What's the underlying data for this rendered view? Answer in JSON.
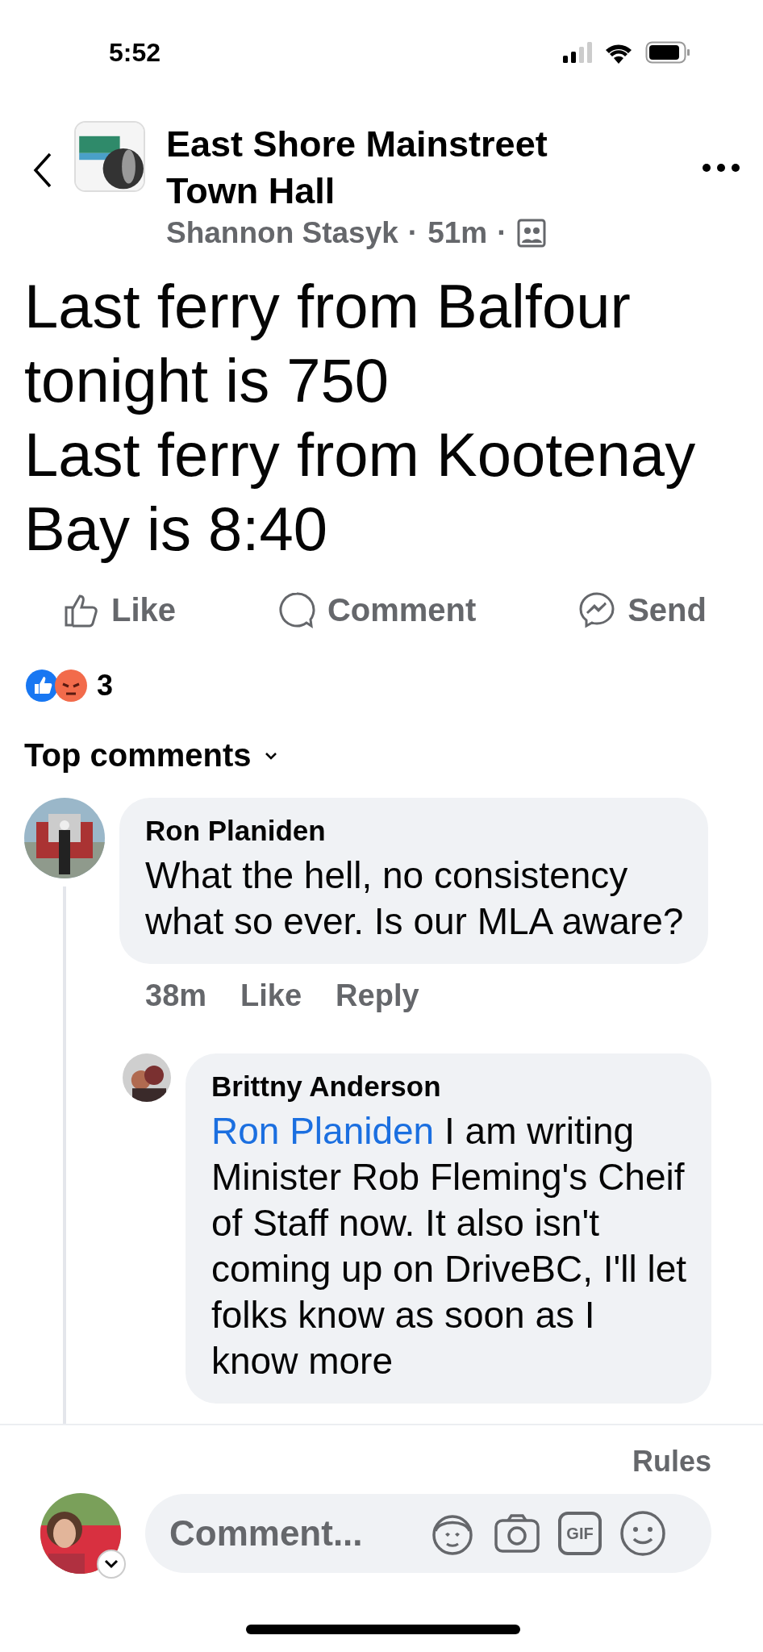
{
  "status_bar": {
    "time": "5:52"
  },
  "header": {
    "group": "East Shore Mainstreet Town Hall",
    "byline": [
      "Shannon Stasyk",
      "·",
      "51m",
      "·"
    ]
  },
  "post": {
    "paragraphs": [
      "Last ferry from Balfour tonight is 750",
      "Last ferry from Kootenay Bay is 8:40"
    ]
  },
  "actions": [
    {
      "kind": "like",
      "label": "Like"
    },
    {
      "kind": "comment",
      "label": "Comment"
    },
    {
      "kind": "send",
      "label": "Send"
    }
  ],
  "reactions": {
    "count": "3"
  },
  "comments_header": {
    "title": "Top comments"
  },
  "comments": [
    {
      "author": "Ron Planiden",
      "text": "What the hell, no consistency what so ever. Is our MLA aware?",
      "time": "38m",
      "actions": [
        "Like",
        "Reply"
      ],
      "replies": [
        {
          "author": "Brittny Anderson",
          "mention": "Ron Planiden",
          "text": "I am writing Minister Rob Fleming's Cheif of Staff now. It also isn't coming up on DriveBC, I'll let folks know as soon as I know more"
        }
      ]
    }
  ],
  "composer": {
    "rules": "Rules",
    "placeholder": "Comment...",
    "gif": "GIF"
  }
}
